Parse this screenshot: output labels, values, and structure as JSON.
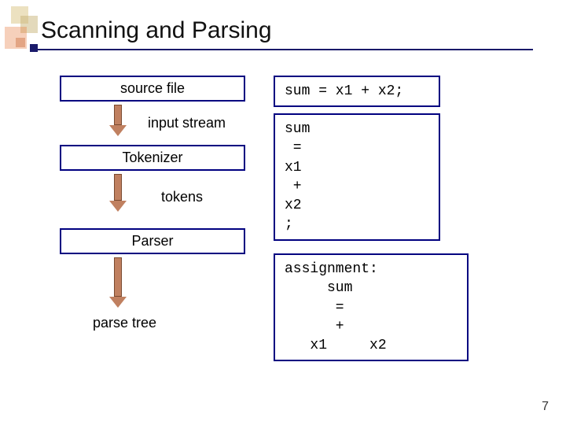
{
  "title": "Scanning and Parsing",
  "stages": {
    "source_file": "source file",
    "tokenizer": "Tokenizer",
    "parser": "Parser"
  },
  "flow_labels": {
    "input_stream": "input stream",
    "tokens": "tokens",
    "parse_tree": "parse tree"
  },
  "code": {
    "source_line": "sum = x1 + x2;",
    "tokens_block": "sum\n =\nx1\n +\nx2\n;",
    "parse_block": "assignment:\n     sum\n      =\n      +\n   x1     x2"
  },
  "page_number": "7"
}
